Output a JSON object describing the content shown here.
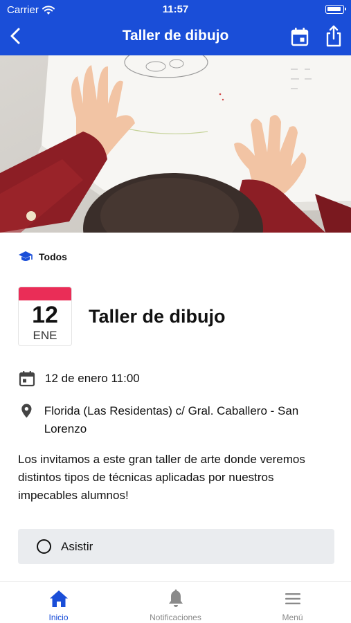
{
  "status_bar": {
    "carrier": "Carrier",
    "time": "11:57"
  },
  "nav": {
    "title": "Taller de dibujo",
    "back_icon": "chevron-left-icon",
    "calendar_icon": "calendar-icon",
    "share_icon": "share-icon"
  },
  "audience": {
    "icon": "graduation-cap-icon",
    "label": "Todos"
  },
  "event": {
    "day": "12",
    "month": "ENE",
    "title": "Taller de dibujo",
    "datetime": "12 de enero 11:00",
    "location": "Florida (Las Residentas) c/ Gral. Caballero - San Lorenzo",
    "description": "Los invitamos a este gran taller de arte donde veremos distintos tipos de técnicas aplicadas por nuestros impecables alumnos!"
  },
  "attend": {
    "label": "Asistir",
    "selected": false
  },
  "tabbar": {
    "items": [
      {
        "label": "Inicio",
        "icon": "home-icon",
        "active": true
      },
      {
        "label": "Notificaciones",
        "icon": "bell-icon",
        "active": false
      },
      {
        "label": "Menú",
        "icon": "menu-icon",
        "active": false
      }
    ]
  },
  "colors": {
    "primary": "#1a4ed8",
    "date_strip": "#ea2d57",
    "attend_bg": "#eaecef",
    "inactive_tab": "#8a8a8a"
  }
}
